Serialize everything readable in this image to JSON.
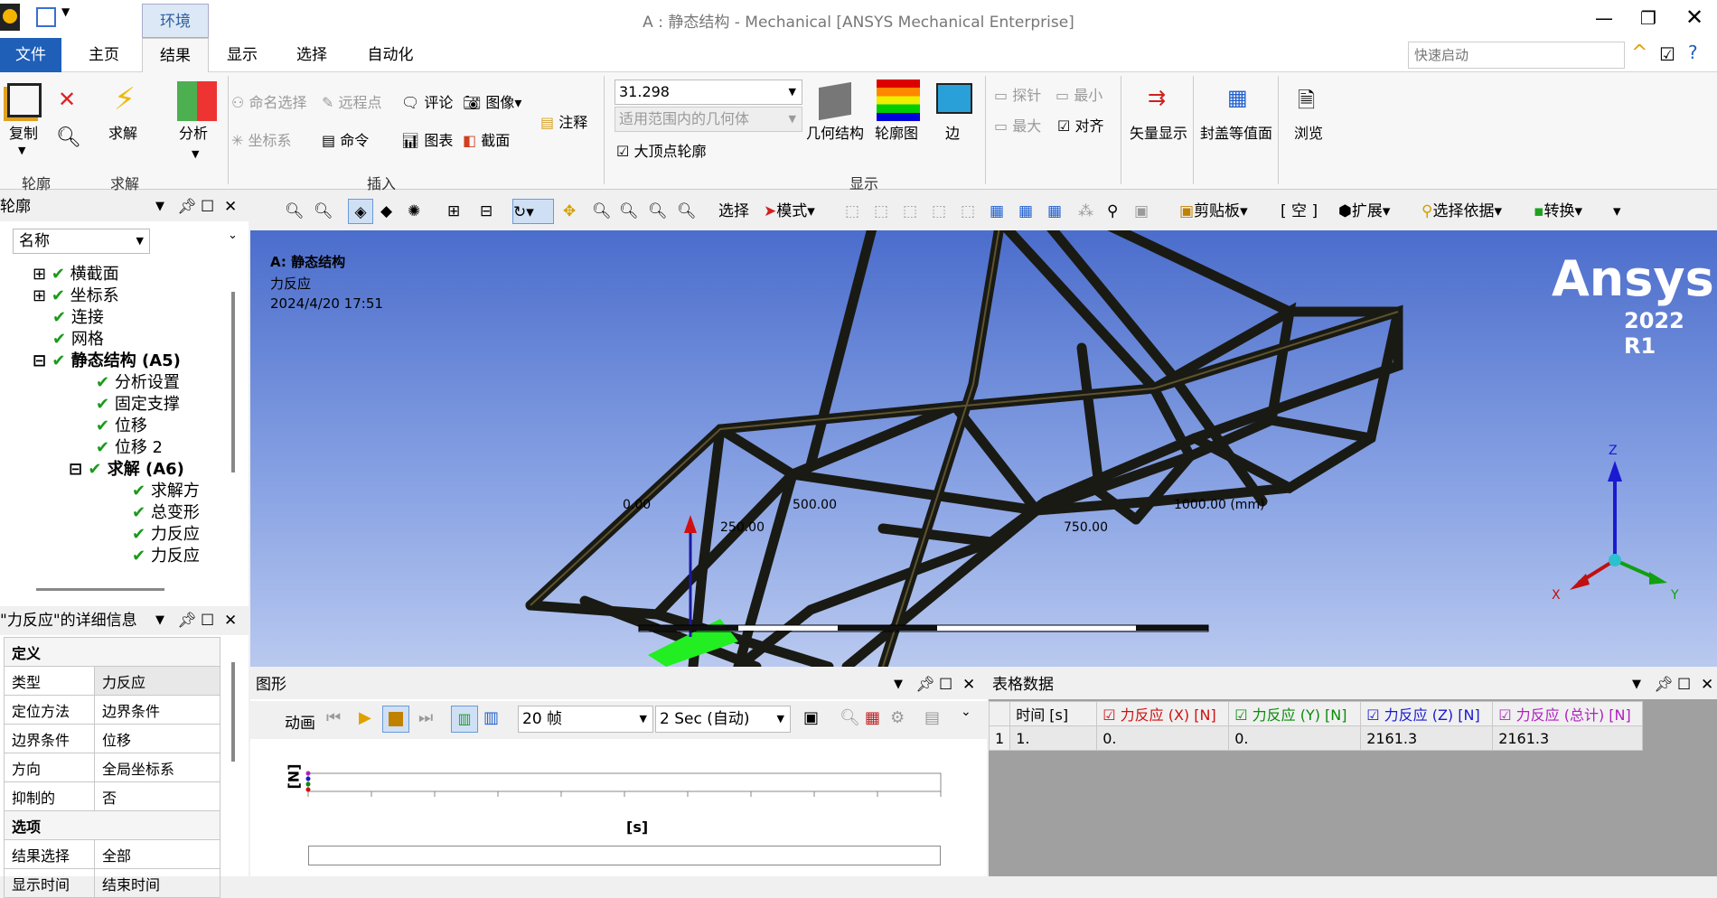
{
  "window": {
    "title": "A : 静态结构 - Mechanical [ANSYS Mechanical Enterprise]",
    "context_tab": "环境",
    "quick_launch_placeholder": "快速启动"
  },
  "tabs": [
    "文件",
    "主页",
    "结果",
    "显示",
    "选择",
    "自动化"
  ],
  "ribbon": {
    "copy": "复制",
    "solve": "求解",
    "analysis": "分析",
    "named_sel": "命名选择",
    "remote_pt": "远程点",
    "comment": "评论",
    "image": "图像",
    "annotation": "注释",
    "coord_sys": "坐标系",
    "command": "命令",
    "chart": "图表",
    "section": "截面",
    "scale_value": "31.298",
    "geom_scope": "适用范围内的几何体",
    "max_vertex": "大顶点轮廓",
    "geometry": "几何结构",
    "contour": "轮廓图",
    "edge": "边",
    "probe": "探针",
    "min": "最小",
    "max": "最大",
    "align": "对齐",
    "vector": "矢量显示",
    "capped": "封盖等值面",
    "browse": "浏览",
    "groups": {
      "outline": "轮廓",
      "solve": "求解",
      "insert": "插入",
      "display": "显示"
    }
  },
  "toolbar": {
    "select": "选择",
    "mode": "模式",
    "clipboard": "剪贴板",
    "empty": "[ 空 ]",
    "extend": "扩展",
    "select_by": "选择依据",
    "convert": "转换"
  },
  "outline": {
    "title": "轮廓",
    "filter": "名称",
    "items": [
      "横截面",
      "坐标系",
      "连接",
      "网格",
      "静态结构 (A5)",
      "分析设置",
      "固定支撑",
      "位移",
      "位移 2",
      "求解 (A6)",
      "求解方",
      "总变形",
      "力反应",
      "力反应"
    ]
  },
  "details": {
    "title": "\"力反应\"的详细信息",
    "section1": "定义",
    "rows": [
      [
        "类型",
        "力反应"
      ],
      [
        "定位方法",
        "边界条件"
      ],
      [
        "边界条件",
        "位移"
      ],
      [
        "方向",
        "全局坐标系"
      ],
      [
        "抑制的",
        "否"
      ]
    ],
    "section2": "选项",
    "rows2": [
      [
        "结果选择",
        "全部"
      ],
      [
        "显示时间",
        "结束时间"
      ]
    ]
  },
  "viewport": {
    "head1": "A: 静态结构",
    "head2": "力反应",
    "head3": "2024/4/20 17:51",
    "brand": "Ansys",
    "version": "2022 R1",
    "scale": [
      "0.00",
      "500.00",
      "1000.00 (mm)",
      "250.00",
      "750.00"
    ],
    "axes": {
      "x": "X",
      "y": "Y",
      "z": "Z"
    }
  },
  "graph": {
    "title": "图形",
    "animation": "动画",
    "frames": "20 帧",
    "duration": "2 Sec (自动)",
    "ylabel": "[N]",
    "xlabel": "[s]"
  },
  "tabular": {
    "title": "表格数据",
    "headers": [
      "时间 [s]",
      "力反应 (X) [N]",
      "力反应 (Y) [N]",
      "力反应 (Z) [N]",
      "力反应 (总计) [N]"
    ],
    "header_colors": [
      "#000000",
      "#d01010",
      "#0a8a0a",
      "#1a1ad0",
      "#b020c0"
    ],
    "rows": [
      [
        "1",
        "1.",
        "0.",
        "0.",
        "2161.3",
        "2161.3"
      ]
    ]
  }
}
